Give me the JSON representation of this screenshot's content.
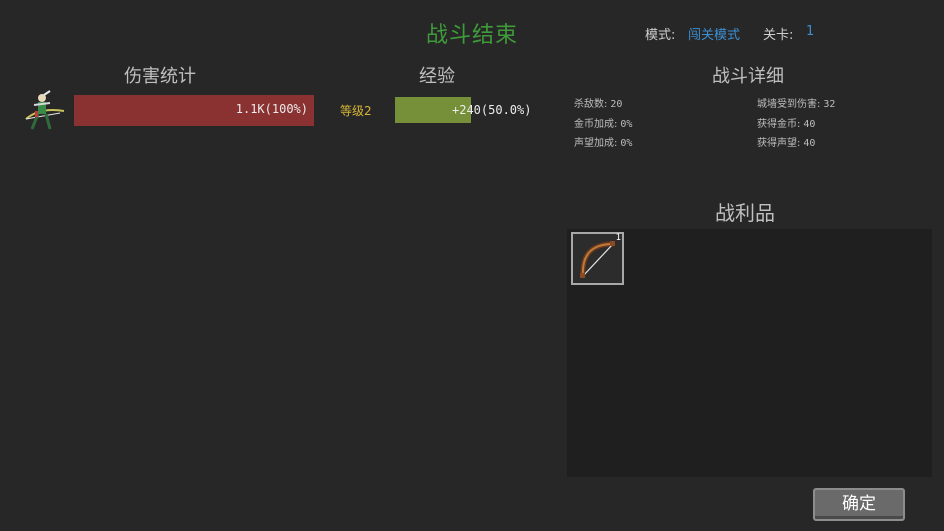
{
  "header": {
    "title": "战斗结束",
    "mode_label": "模式:",
    "mode_value": "闯关模式",
    "stage_label": "关卡:",
    "stage_value": "1"
  },
  "damage": {
    "heading": "伤害统计",
    "hero_icon": "archer-hero-icon",
    "bar_color": "#8a3232",
    "value_text": "1.1K(100%)"
  },
  "experience": {
    "heading": "经验",
    "level_label": "等级2",
    "gain_text": "+240(50.0%)",
    "progress": 0.5,
    "bar_color": "#76903a"
  },
  "battle_details": {
    "heading": "战斗详细",
    "stats": [
      {
        "label": "杀敌数:",
        "value": "20"
      },
      {
        "label": "城墙受到伤害:",
        "value": "32"
      },
      {
        "label": "金币加成:",
        "value": "0%"
      },
      {
        "label": "获得金币:",
        "value": "40"
      },
      {
        "label": "声望加成:",
        "value": "0%"
      },
      {
        "label": "获得声望:",
        "value": "40"
      }
    ]
  },
  "loot": {
    "heading": "战利品",
    "items": [
      {
        "icon": "bow-icon",
        "count": "1"
      }
    ]
  },
  "confirm_label": "确定",
  "colors": {
    "title_green": "#3f9a3a",
    "link_blue": "#3e8fd1",
    "level_yellow": "#d6b635"
  }
}
